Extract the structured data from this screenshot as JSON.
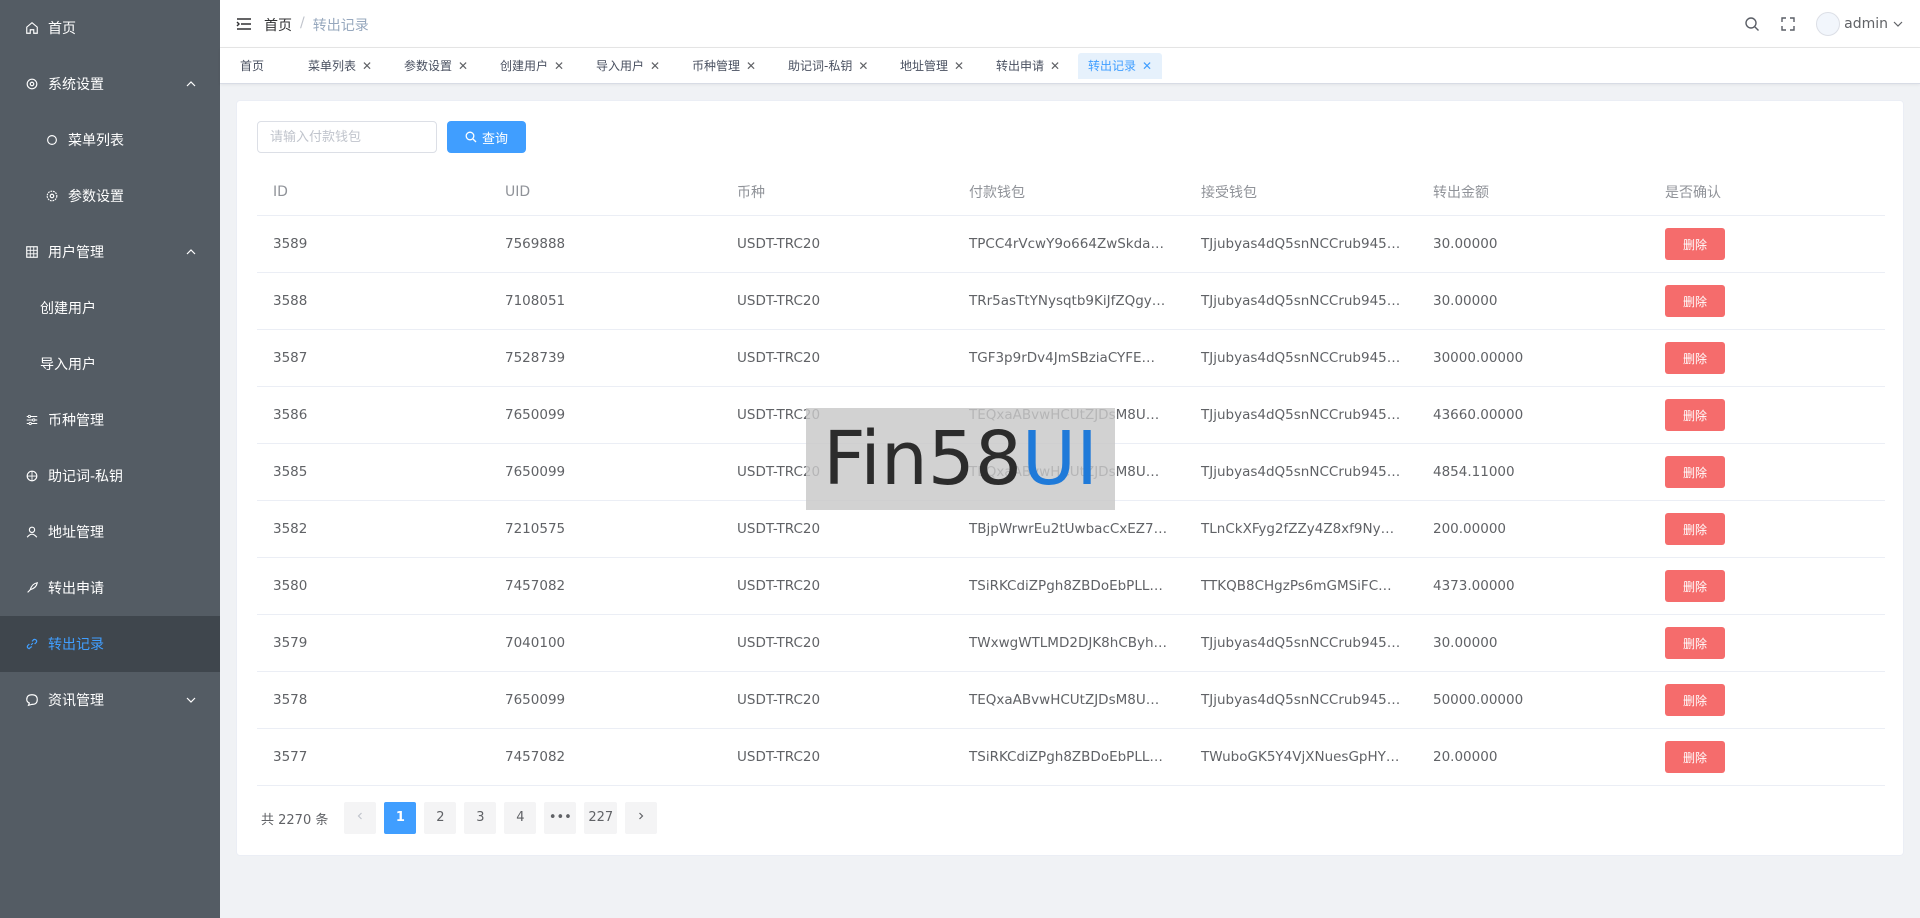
{
  "sidebar": {
    "items": [
      {
        "label": "首页",
        "icon": "home-icon"
      },
      {
        "label": "系统设置",
        "icon": "gear-icon",
        "expanded": true
      },
      {
        "label": "菜单列表",
        "icon": "circle-icon"
      },
      {
        "label": "参数设置",
        "icon": "gear-icon"
      },
      {
        "label": "用户管理",
        "icon": "users-icon",
        "expanded": true
      },
      {
        "label": "创建用户"
      },
      {
        "label": "导入用户"
      },
      {
        "label": "币种管理",
        "icon": "sliders-icon"
      },
      {
        "label": "助记词-私钥",
        "icon": "key-icon"
      },
      {
        "label": "地址管理",
        "icon": "user-icon"
      },
      {
        "label": "转出申请",
        "icon": "rocket-icon"
      },
      {
        "label": "转出记录",
        "icon": "link-icon",
        "active": true
      },
      {
        "label": "资讯管理",
        "icon": "chat-icon",
        "expanded": false
      }
    ]
  },
  "header": {
    "breadcrumb": [
      "首页",
      "转出记录"
    ],
    "separator": "/",
    "user": "admin"
  },
  "tags": [
    {
      "label": "首页"
    },
    {
      "label": "菜单列表"
    },
    {
      "label": "参数设置"
    },
    {
      "label": "创建用户"
    },
    {
      "label": "导入用户"
    },
    {
      "label": "币种管理"
    },
    {
      "label": "助记词-私钥"
    },
    {
      "label": "地址管理"
    },
    {
      "label": "转出申请"
    },
    {
      "label": "转出记录",
      "active": true
    }
  ],
  "search": {
    "placeholder": "请输入付款钱包",
    "button_label": "查询"
  },
  "table": {
    "headers": [
      "ID",
      "UID",
      "币种",
      "付款钱包",
      "接受钱包",
      "转出金额",
      "是否确认"
    ],
    "delete_label": "删除",
    "rows": [
      [
        "3589",
        "7569888",
        "USDT-TRC20",
        "TPCC4rVcwY9o664ZwSkdax…",
        "TJjubyas4dQ5snNCCrub945…",
        "30.00000"
      ],
      [
        "3588",
        "7108051",
        "USDT-TRC20",
        "TRr5asTtYNysqtb9KiJfZQgyz…",
        "TJjubyas4dQ5snNCCrub945…",
        "30.00000"
      ],
      [
        "3587",
        "7528739",
        "USDT-TRC20",
        "TGF3p9rDv4JmSBziaCYFE…",
        "TJjubyas4dQ5snNCCrub945…",
        "30000.00000"
      ],
      [
        "3586",
        "7650099",
        "USDT-TRC20",
        "TEQxaABvwHCUtZJDsM8U…",
        "TJjubyas4dQ5snNCCrub945…",
        "43660.00000"
      ],
      [
        "3585",
        "7650099",
        "USDT-TRC20",
        "TEQxaABvwHCUtZJDsM8U…",
        "TJjubyas4dQ5snNCCrub945…",
        "4854.11000"
      ],
      [
        "3582",
        "7210575",
        "USDT-TRC20",
        "TBjpWrwrEu2tUwbacCxEZ7h…",
        "TLnCkXFyg2fZZy4Z8xf9Ny1…",
        "200.00000"
      ],
      [
        "3580",
        "7457082",
        "USDT-TRC20",
        "TSiRKCdiZPgh8ZBDoEbPLL…",
        "TTKQB8CHgzPs6mGMSiFC…",
        "4373.00000"
      ],
      [
        "3579",
        "7040100",
        "USDT-TRC20",
        "TWxwgWTLMD2DJK8hCByh…",
        "TJjubyas4dQ5snNCCrub945…",
        "30.00000"
      ],
      [
        "3578",
        "7650099",
        "USDT-TRC20",
        "TEQxaABvwHCUtZJDsM8U…",
        "TJjubyas4dQ5snNCCrub945…",
        "50000.00000"
      ],
      [
        "3577",
        "7457082",
        "USDT-TRC20",
        "TSiRKCdiZPgh8ZBDoEbPLL…",
        "TWuboGK5Y4VjXNuesGpHY…",
        "20.00000"
      ]
    ]
  },
  "pagination": {
    "total": "共 2270 条",
    "pages": [
      "1",
      "2",
      "3",
      "4",
      "•••",
      "227"
    ],
    "current": "1"
  },
  "watermark": {
    "part1": "Fin58",
    "part2": "UI"
  },
  "colors": {
    "primary": "#409eff",
    "danger": "#f56c6c",
    "sidebar": "#545c64"
  }
}
